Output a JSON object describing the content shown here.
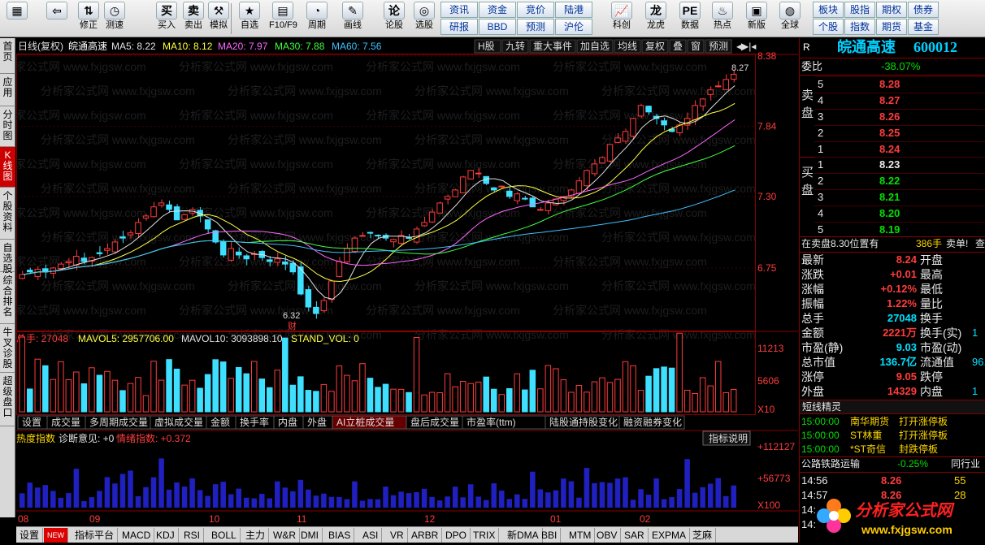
{
  "toolbar": {
    "buttons": [
      {
        "label": "",
        "icon": "grid-icon"
      },
      {
        "label": "",
        "icon": "back-arrow-icon"
      },
      {
        "label": "修正",
        "icon": "up-down-icon"
      },
      {
        "label": "测速",
        "icon": "speed-icon"
      },
      {
        "label": "买入",
        "icon": "buy-icon"
      },
      {
        "label": "卖出",
        "icon": "sell-icon"
      },
      {
        "label": "模拟",
        "icon": "hammer-icon"
      },
      {
        "label": "自选",
        "icon": "star-icon"
      },
      {
        "label": "F10/F9",
        "icon": "f10-icon"
      },
      {
        "label": "周期",
        "icon": "period-icon"
      },
      {
        "label": "画线",
        "icon": "pen-icon"
      },
      {
        "label": "论股",
        "icon": "discuss-icon"
      },
      {
        "label": "选股",
        "icon": "select-stock-icon"
      }
    ],
    "menu1": [
      "资讯",
      "资金",
      "竞价",
      "陆港",
      "研报",
      "BBD",
      "预测",
      "沪伦"
    ],
    "buttons2": [
      {
        "label": "科创",
        "icon": "chart-icon"
      },
      {
        "label": "龙虎",
        "icon": "dragon-icon"
      },
      {
        "label": "数据",
        "icon": "pe-icon"
      },
      {
        "label": "热点",
        "icon": "hot-icon"
      },
      {
        "label": "新版",
        "icon": "new-version-icon"
      },
      {
        "label": "全球",
        "icon": "globe-icon"
      }
    ],
    "menu2": [
      "板块",
      "股指",
      "期权",
      "债券",
      "个股",
      "指数",
      "期货",
      "基金"
    ]
  },
  "leftnav": [
    "首页",
    "应用",
    "分时图",
    "K线图",
    "个股资料",
    "自选股",
    "综合排名",
    "牛叉诊股",
    "超级盘口"
  ],
  "header": {
    "chart_title": "日线(复权)",
    "stock": "皖通高速",
    "ma5": "MA5: 8.22",
    "ma10": "MA10: 8.12",
    "ma20": "MA20: 7.97",
    "ma30": "MA30: 7.88",
    "ma60": "MA60: 7.56",
    "tabs": [
      "H股",
      "九转",
      "重大事件",
      "加自选",
      "均线",
      "复权",
      "叠",
      "窗",
      "预测"
    ]
  },
  "y_prices": [
    "8.38",
    "7.84",
    "7.30",
    "6.75"
  ],
  "annotations": {
    "high": "8.27",
    "low": "6.32",
    "low_mark": "财"
  },
  "vol_header": {
    "total": "总手: 27048",
    "mavol5": "MAVOL5: 2957706.00",
    "mavol10": "MAVOL10: 3093898.10",
    "stand": "STAND_VOL: 0"
  },
  "vol_axis": [
    "11213",
    "5606",
    "X10"
  ],
  "vol_tabs": [
    "设置",
    "成交量",
    "多周期成交量",
    "虚拟成交量",
    "金额",
    "换手率",
    "内盘",
    "外盘",
    "AI立桩成交量",
    "盘后成交量",
    "市盈率(ttm)",
    "陆股通持股变化",
    "融资融券变化"
  ],
  "heat_header": {
    "label": "热度指数",
    "diag": "诊断意见: +0",
    "mood": "情绪指数: +0.372",
    "explain": "指标说明"
  },
  "heat_axis": [
    "+112127",
    "+56773",
    "X100"
  ],
  "x_months": [
    "08",
    "09",
    "10",
    "11",
    "12",
    "01",
    "02"
  ],
  "bottom_tabs": [
    "设置",
    "NEW",
    "指标平台",
    "MACD",
    "KDJ",
    "RSI",
    "BOLL",
    "主力",
    "W&R",
    "DMI",
    "BIAS",
    "ASI",
    "VR",
    "ARBR",
    "DPO",
    "TRIX",
    "新DMA",
    "BBI",
    "MTM",
    "OBV",
    "SAR",
    "EXPMA",
    "芝麻"
  ],
  "right": {
    "r": "R",
    "name": "皖通高速",
    "code": "600012",
    "weibi_label": "委比",
    "weibi": "-38.07%",
    "sell": [
      {
        "n": "5",
        "p": "8.28"
      },
      {
        "n": "4",
        "p": "8.27"
      },
      {
        "n": "3",
        "p": "8.26"
      },
      {
        "n": "2",
        "p": "8.25"
      },
      {
        "n": "1",
        "p": "8.24"
      }
    ],
    "buy": [
      {
        "n": "1",
        "p": "8.23"
      },
      {
        "n": "2",
        "p": "8.22"
      },
      {
        "n": "3",
        "p": "8.21"
      },
      {
        "n": "4",
        "p": "8.20"
      },
      {
        "n": "5",
        "p": "8.19"
      }
    ],
    "sell_label": "卖盘",
    "buy_label": "买盘",
    "notice": "在卖盘8.30位置有",
    "notice_qty": "386手",
    "notice_act": "卖单!",
    "notice_more": "查",
    "stats": [
      [
        "最新",
        "8.24",
        "开盘",
        ""
      ],
      [
        "涨跌",
        "+0.01",
        "最高",
        ""
      ],
      [
        "涨幅",
        "+0.12%",
        "最低",
        ""
      ],
      [
        "振幅",
        "1.22%",
        "量比",
        ""
      ],
      [
        "总手",
        "27048",
        "换手",
        ""
      ],
      [
        "金额",
        "2221万",
        "换手(实)",
        "1"
      ],
      [
        "市盈(静)",
        "9.03",
        "市盈(动)",
        ""
      ],
      [
        "总市值",
        "136.7亿",
        "流通值",
        "96."
      ],
      [
        "涨停",
        "9.05",
        "跌停",
        ""
      ],
      [
        "外盘",
        "14329",
        "内盘",
        "1"
      ]
    ],
    "sprite_title": "短线精灵",
    "sprites": [
      [
        "15:00:00",
        "南华期货",
        "打开涨停板"
      ],
      [
        "15:00:00",
        "ST林重",
        "打开涨停板"
      ],
      [
        "15:00:00",
        "*ST奇信",
        "封跌停板"
      ]
    ],
    "sector": "公路铁路运输",
    "sector_chg": "-0.25%",
    "sector_more": "同行业",
    "ticks": [
      [
        "14:56",
        "8.26",
        "55"
      ],
      [
        "14:57",
        "8.26",
        "28"
      ],
      [
        "14:",
        "",
        ""
      ],
      [
        "14:",
        "",
        ""
      ]
    ],
    "logo_text": "分析家公式网",
    "logo_url": "www.fxjgsw.com"
  },
  "watermark": "分析家公式网 www.fxjgsw.com",
  "colors": {
    "up": "#ff3c3c",
    "down": "#3fe0ff",
    "ma5": "#e0e0e0",
    "ma10": "#ffff40",
    "ma20": "#ff66ff",
    "ma30": "#40ff40",
    "ma60": "#40c0ff",
    "heat": "#2020c0"
  },
  "chart_data": {
    "type": "candlestick",
    "note": "daily K-line of 皖通高速 600012, Aug–Feb",
    "price_range": [
      6.3,
      8.38
    ],
    "closes": [
      6.7,
      6.72,
      6.74,
      6.72,
      6.75,
      6.78,
      6.8,
      6.84,
      6.8,
      6.83,
      6.86,
      6.9,
      6.95,
      6.98,
      7.02,
      7.1,
      7.15,
      7.22,
      7.25,
      7.2,
      7.12,
      7.16,
      7.2,
      7.15,
      7.05,
      6.95,
      6.85,
      6.9,
      6.85,
      6.82,
      6.86,
      6.83,
      6.8,
      6.82,
      6.78,
      6.72,
      6.55,
      6.45,
      6.4,
      6.5,
      6.65,
      6.8,
      6.9,
      6.98,
      7.0,
      7.02,
      7.0,
      6.98,
      6.97,
      7.0,
      6.98,
      7.05,
      7.1,
      7.18,
      7.25,
      7.3,
      7.35,
      7.45,
      7.5,
      7.48,
      7.4,
      7.35,
      7.38,
      7.3,
      7.32,
      7.28,
      7.22,
      7.2,
      7.25,
      7.28,
      7.3,
      7.35,
      7.42,
      7.5,
      7.55,
      7.6,
      7.7,
      7.75,
      7.8,
      7.9,
      8.0,
      7.95,
      7.9,
      7.85,
      7.8,
      7.85,
      7.9,
      8.0,
      8.05,
      8.12,
      8.15,
      8.2,
      8.24
    ]
  }
}
